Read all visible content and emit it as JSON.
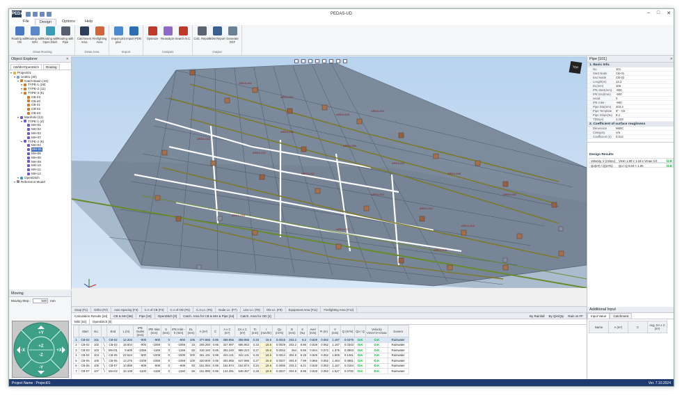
{
  "app": {
    "title": "PEDAS-UD",
    "logo": "PEDAS"
  },
  "menu": {
    "tabs": [
      "File",
      "Design",
      "Options",
      "Help"
    ],
    "active": 1
  },
  "ribbon": {
    "groups": [
      {
        "name": "Draw Routing",
        "buttons": [
          {
            "label": "Routing with CB",
            "icon": "routing-cb-icon",
            "color": "#4a78c2"
          },
          {
            "label": "Routing with M/H",
            "icon": "routing-mh-icon",
            "color": "#5b88c9"
          },
          {
            "label": "Routing with Open Ditch",
            "icon": "routing-ditch-icon",
            "color": "#3d9ab5"
          },
          {
            "label": "Routing with Pipe",
            "icon": "routing-pipe-icon",
            "color": "#555f6e"
          }
        ]
      },
      {
        "name": "Draw Area",
        "buttons": [
          {
            "label": "Catchment Area",
            "icon": "catchment-icon",
            "color": "#2e3f5c"
          },
          {
            "label": "Firefighting Area",
            "icon": "firefighting-icon",
            "color": "#d0643a"
          }
        ]
      },
      {
        "name": "Import",
        "buttons": [
          {
            "label": "Import plot plan",
            "icon": "import-plot-icon",
            "color": "#4a8ad0"
          },
          {
            "label": "Import PDN",
            "icon": "import-pdn-icon",
            "color": "#2b6fb0"
          }
        ]
      },
      {
        "name": "Analysis",
        "buttons": [
          {
            "label": "Optimize",
            "icon": "optimize-icon",
            "color": "#c0392b"
          },
          {
            "label": "Reanalyze",
            "icon": "reanalyze-icon",
            "color": "#8e6ac8"
          },
          {
            "label": "Search N.C.",
            "icon": "search-icon",
            "color": "#c0392b"
          }
        ]
      },
      {
        "name": "Output",
        "buttons": [
          {
            "label": "Calc. Report",
            "icon": "calc-report-icon",
            "color": "#5b6470"
          },
          {
            "label": "BOM Report",
            "icon": "bom-report-icon",
            "color": "#3b5f8f"
          },
          {
            "label": "Generate DXF",
            "icon": "generate-dxf-icon",
            "color": "#6b7f95"
          }
        ]
      }
    ]
  },
  "explorer": {
    "title": "Object Explorer",
    "tabs": [
      "CB/MH/OpenDitch",
      "Routing"
    ],
    "tree": [
      {
        "level": 0,
        "label": "Project01",
        "color": "#e3b341"
      },
      {
        "level": 1,
        "label": "Unit01 (30)",
        "color": "#7fa0d0"
      },
      {
        "level": 2,
        "label": "Catch Basin (44)",
        "color": "#d07a2a"
      },
      {
        "level": 3,
        "label": "TYPE-1 (28)",
        "color": "#d07a2a"
      },
      {
        "level": 3,
        "label": "TYPE-2 (11)",
        "color": "#d07a2a"
      },
      {
        "level": 3,
        "label": "TYPE-3 (5)",
        "color": "#d07a2a"
      },
      {
        "level": 4,
        "label": "CB-23",
        "color": "#d07a2a"
      },
      {
        "level": 4,
        "label": "CB-40",
        "color": "#d07a2a"
      },
      {
        "level": 4,
        "label": "CB-41",
        "color": "#d07a2a"
      },
      {
        "level": 4,
        "label": "CB-42",
        "color": "#d07a2a"
      },
      {
        "level": 4,
        "label": "CB-43",
        "color": "#d07a2a"
      },
      {
        "level": 2,
        "label": "Manhole (12)",
        "color": "#6a5acd"
      },
      {
        "level": 3,
        "label": "TYPE-1 (4)",
        "color": "#6a5acd"
      },
      {
        "level": 4,
        "label": "MH-01",
        "color": "#6a5acd"
      },
      {
        "level": 4,
        "label": "MH-02",
        "color": "#6a5acd"
      },
      {
        "level": 4,
        "label": "MH-03",
        "color": "#6a5acd"
      },
      {
        "level": 4,
        "label": "MH-07",
        "color": "#6a5acd"
      },
      {
        "level": 3,
        "label": "TYPE-2 (8)",
        "color": "#6a5acd"
      },
      {
        "level": 4,
        "label": "MH-04",
        "color": "#6a5acd"
      },
      {
        "level": 4,
        "label": "MH-05",
        "color": "#6a5acd",
        "selected": true
      },
      {
        "level": 4,
        "label": "MH-06",
        "color": "#6a5acd"
      },
      {
        "level": 4,
        "label": "MH-08",
        "color": "#6a5acd"
      },
      {
        "level": 4,
        "label": "MH-09",
        "color": "#6a5acd"
      },
      {
        "level": 4,
        "label": "MH-10",
        "color": "#6a5acd"
      },
      {
        "level": 4,
        "label": "MH-11",
        "color": "#6a5acd"
      },
      {
        "level": 4,
        "label": "MH-12",
        "color": "#6a5acd"
      },
      {
        "level": 2,
        "label": "OpenDitch",
        "color": "#3d9ab5"
      },
      {
        "level": 1,
        "label": "Reference Model",
        "color": "#888888"
      }
    ]
  },
  "moving": {
    "title": "Moving",
    "step_label": "Moving Step :",
    "step_value": "500",
    "unit": "mm",
    "dirs": {
      "up": "+Y",
      "down": "-Y",
      "left": "-X",
      "right": "+X",
      "zup": "+Z",
      "zdown": "-Z"
    }
  },
  "viewport": {
    "areas": [
      "AREA-001",
      "AREA-002",
      "AREA-003",
      "AREA-004",
      "AREA-005",
      "AREA-006",
      "AREA-007",
      "AREA-008",
      "AREA-009",
      "AREA-010",
      "AREA-011",
      "AREA-012",
      "AREA-013",
      "AREA-014",
      "AREA-015",
      "AREA-016",
      "AREA-017",
      "AREA-018"
    ],
    "navcube": "TOP"
  },
  "viewtabs": [
    "Snap (F1)",
    "Ortho (F2)",
    "Auto Spacing (F3)",
    "C.A of CB (F4)",
    "C.A of OD (F5)",
    "C.A Ln. (F6)",
    "Node Ln. (F7)",
    "Line Ln. (F8)",
    "OD Ln. (F9)",
    "Equipment Area (F11)",
    "Firefighting Area (F12)"
  ],
  "bottom": {
    "tabs": [
      "Calculation Results [34]",
      "CB & MH [56]",
      "Pipe [34]",
      "OpenDitch [0]",
      "Catch. Area for CB & MH & Pipe [44]",
      "Catch. Area for OD [1]"
    ],
    "options": [
      "By Rainfall",
      "By Qin/Qty",
      "Rain vs FF"
    ],
    "subtabs": [
      "M/D [34]",
      "OpenDitch [0]"
    ],
    "columns": [
      "",
      "Start",
      "No.",
      "",
      "End",
      "L (m)",
      "IPE Outlet (mm)",
      "IPE Inlet (mm)",
      "S (mm)",
      "IPE Inlet - h (mm)",
      "EL (mm)",
      "A (m²)",
      "C",
      "A x C (m²)",
      "ΣA x C (m²)",
      "Tc (min)",
      "I (mm/hr)",
      "Qo (m³/s)",
      "D (mm)",
      "S (‰)",
      "Avel (m/s)",
      "R (m)",
      "V (m/s)",
      "Q (m³/s)",
      "Qo / Q",
      "Velocity Vmin<V<Vmax",
      "Govern"
    ],
    "rows": [
      [
        "1",
        "CB-02",
        "101",
        "",
        "CB-02",
        "12.204",
        "-900",
        "-900",
        "0",
        "-900",
        "106",
        "377.866",
        "0.95",
        "358.956",
        "358.956",
        "0.33",
        "15.6",
        "0.0015",
        "203.2",
        "8.2",
        "0.829",
        "0.062",
        "1.167",
        "0.0376",
        "O.K",
        "O.K",
        "Rainwater"
      ],
      [
        "2",
        "CB-02",
        "102",
        "",
        "CB-03",
        "18.604",
        "-900",
        "-1059",
        "0",
        "-1059",
        "15",
        "205.260",
        "0.95",
        "327.997",
        "686.953",
        "0.33",
        "15.6",
        "0.0029",
        "203.2",
        "8.86",
        "0.829",
        "0.062",
        "1.167",
        "0.0343",
        "O.K",
        "O.K",
        "Rainwater"
      ],
      [
        "3",
        "CB-03",
        "103",
        "",
        "MH-01",
        "9.608",
        "-1059",
        "-1169",
        "0",
        "-1169",
        "50",
        "316.150",
        "0.95",
        "302.240",
        "989.224",
        "0.27",
        "15.6",
        "0.0042",
        "254",
        "5.56",
        "0.944",
        "0.072",
        "1.376",
        "0.0563",
        "O.K",
        "O.K",
        "Rainwater"
      ],
      [
        "4",
        "CB-04",
        "104",
        "",
        "CB-05",
        "22.524",
        "-800",
        "-1009",
        "0",
        "-1009",
        "200",
        "361.191",
        "0.95",
        "343.131",
        "343.131",
        "0.25",
        "15.6",
        "0.0014",
        "304.8",
        "9.28",
        "0.829",
        "0.062",
        "1.605",
        "0.1461",
        "O.K",
        "O.K",
        "Rainwater"
      ],
      [
        "5",
        "CB-05",
        "105",
        "",
        "CB-06",
        "13.276",
        "-1009",
        "-1059",
        "0",
        "-1059",
        "100",
        "320.900",
        "0.95",
        "304.855",
        "647.986",
        "0.27",
        "15.6",
        "0.0027",
        "304.8",
        "7.99",
        "0.866",
        "0.062",
        "1.484",
        "0.0881",
        "O.K",
        "O.K",
        "Rainwater"
      ],
      [
        "6",
        "CB-06",
        "106",
        "",
        "CB-07",
        "10.858",
        "-808",
        "-908",
        "0",
        "-908",
        "50",
        "161.084",
        "0.95",
        "152.874",
        "152.874",
        "0.34",
        "15.6",
        "0.0006",
        "203.2",
        "9.21",
        "0.829",
        "0.062",
        "1.167",
        "0.0164",
        "O.K",
        "O.K",
        "Rainwater"
      ],
      [
        "7",
        "CB-07",
        "107",
        "",
        "MH-02",
        "10.108",
        "-1100",
        "-1159",
        "0",
        "-1150",
        "56",
        "151.990",
        "0.95",
        "144.391",
        "648.357",
        "0.29",
        "15.6",
        "0.0027",
        "304.8",
        "8.85",
        "0.829",
        "0.062",
        "1.527",
        "0.0792",
        "O.K",
        "O.K",
        "Rainwater"
      ]
    ]
  },
  "props": {
    "title": "Pipe [101]",
    "sections": [
      {
        "name": "1. Basic Info.",
        "rows": [
          [
            "No.",
            "101"
          ],
          [
            "Start Node",
            "CB-01"
          ],
          [
            "End Node",
            "CB-02"
          ],
          [
            "Length(m)",
            "12.2"
          ],
          [
            "EL(mm)",
            "106"
          ],
          [
            "IPE Start(mm)",
            "-900"
          ],
          [
            "IPE End(mm)",
            "-900"
          ],
          [
            "Head Load(mm)",
            "0"
          ],
          [
            "IPE Inlet - Head Load(mm)",
            "-900"
          ],
          [
            "Pipe Dia(mm)",
            "203.2"
          ],
          [
            "Pipe Template",
            "8\" - C6"
          ],
          [
            "Pipe Slope(‰)",
            "8.2"
          ],
          [
            "T(Days)",
            "1.223"
          ]
        ]
      },
      {
        "name": "2. Coefficient of surface roughness",
        "rows": [
          [
            "Dimension",
            "M60C"
          ],
          [
            "Category",
            "n/a"
          ],
          [
            "Coefficient (n)",
            "0.012"
          ]
        ]
      }
    ],
    "design_title": "Design Results",
    "design": [
      {
        "k": "Velocity, V (m/sec)",
        "v": "Vmin 1.60 ≤ 1.18 ≤ Vmax 3.0",
        "s": "O.K"
      },
      {
        "k": "Qo(m³) / Q(m³/s)",
        "v": "Qo / Q 0.84 < 1.00",
        "s": "O.K"
      }
    ],
    "additional": {
      "title": "Additional Input",
      "tabs": [
        "Input Value",
        "Catchment"
      ],
      "cols": [
        "Name",
        "A (m²)",
        "C",
        "Avg. ΣA x C (m²)"
      ]
    }
  },
  "status": {
    "project": "Project Name : Project01",
    "version": "Ver. 7.10.2024"
  },
  "colors": {
    "accent": "#1f3a6e",
    "ok": "#00aa33",
    "selected": "#3b6dc5"
  }
}
